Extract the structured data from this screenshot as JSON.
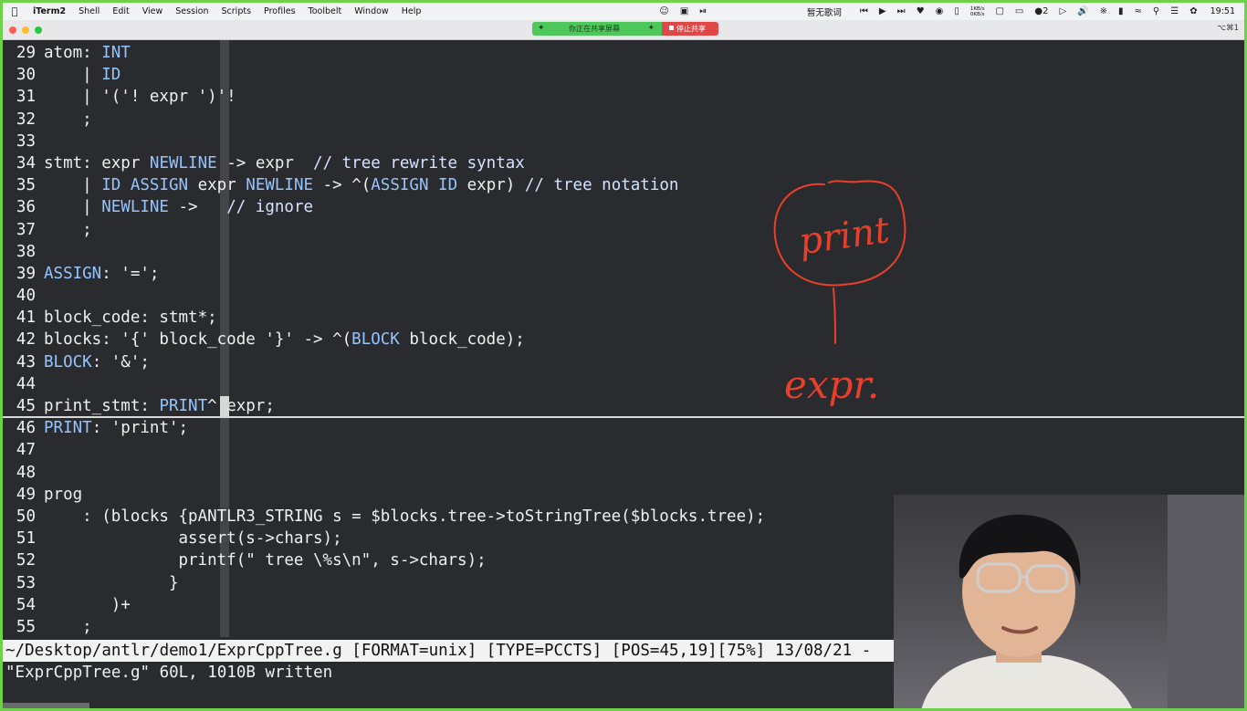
{
  "menubar": {
    "apple_icon": "apple-icon",
    "items": [
      "iTerm2",
      "Shell",
      "Edit",
      "View",
      "Session",
      "Scripts",
      "Profiles",
      "Toolbelt",
      "Window",
      "Help"
    ],
    "lyrics": "暂无歌词",
    "net_up": "1KB/s",
    "net_down": "0KB/s",
    "badge_count": "2",
    "clock": "19:51"
  },
  "titlebar": {
    "sharing_label": "你正在共享屏幕",
    "stop_label": "停止共享",
    "shortcut": "⌥⌘1"
  },
  "editor": {
    "lines": [
      {
        "n": "29",
        "text": "atom: INT"
      },
      {
        "n": "30",
        "text": "    | ID"
      },
      {
        "n": "31",
        "text": "    | '('! expr ')'!"
      },
      {
        "n": "32",
        "text": "    ;"
      },
      {
        "n": "33",
        "text": ""
      },
      {
        "n": "34",
        "text": "stmt: expr NEWLINE -> expr  // tree rewrite syntax"
      },
      {
        "n": "35",
        "text": "    | ID ASSIGN expr NEWLINE -> ^(ASSIGN ID expr) // tree notation"
      },
      {
        "n": "36",
        "text": "    | NEWLINE ->   // ignore"
      },
      {
        "n": "37",
        "text": "    ;"
      },
      {
        "n": "38",
        "text": ""
      },
      {
        "n": "39",
        "text": "ASSIGN: '=';"
      },
      {
        "n": "40",
        "text": ""
      },
      {
        "n": "41",
        "text": "block_code: stmt*;"
      },
      {
        "n": "42",
        "text": "blocks: '{' block_code '}' -> ^(BLOCK block_code);"
      },
      {
        "n": "43",
        "text": "BLOCK: '&';"
      },
      {
        "n": "44",
        "text": ""
      },
      {
        "n": "45",
        "text": "print_stmt: PRINT^ expr;"
      },
      {
        "n": "46",
        "text": "PRINT: 'print';"
      },
      {
        "n": "47",
        "text": ""
      },
      {
        "n": "48",
        "text": ""
      },
      {
        "n": "49",
        "text": "prog"
      },
      {
        "n": "50",
        "text": "    : (blocks {pANTLR3_STRING s = $blocks.tree->toStringTree($blocks.tree);"
      },
      {
        "n": "51",
        "text": "              assert(s->chars);"
      },
      {
        "n": "52",
        "text": "              printf(\" tree \\%s\\n\", s->chars);"
      },
      {
        "n": "53",
        "text": "             }"
      },
      {
        "n": "54",
        "text": "       )+"
      },
      {
        "n": "55",
        "text": "    ;"
      }
    ],
    "status_line": "~/Desktop/antlr/demo1/ExprCppTree.g [FORMAT=unix] [TYPE=PCCTS] [POS=45,19][75%] 13/08/21 -",
    "message_line": "\"ExprCppTree.g\" 60L, 1010B written"
  },
  "annotation": {
    "circled_word": "print",
    "child_word": "expr."
  },
  "colors": {
    "frame_border": "#6fd04a",
    "terminal_bg": "#2a2b2e",
    "keyword": "#95c4ff",
    "ink": "#e8402a",
    "share_green": "#4fc85b",
    "stop_red": "#e04848"
  },
  "webcam": {
    "label": "presenter webcam"
  }
}
